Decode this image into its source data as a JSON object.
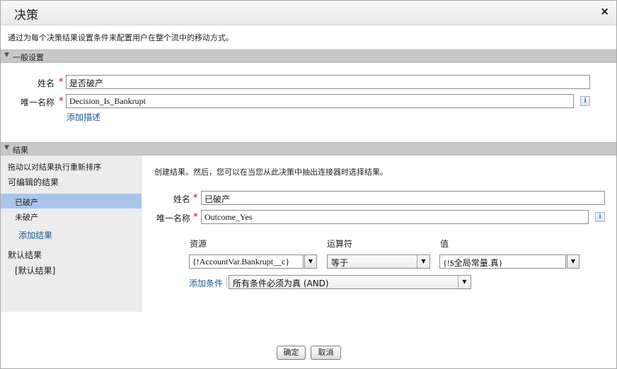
{
  "dialog": {
    "title": "决策",
    "close_glyph": "×",
    "description": "通过为每个决策结果设置条件来配置用户在整个流中的移动方式。"
  },
  "general": {
    "section_title": "一般设置",
    "collapse_glyph": "▼",
    "name_label": "姓名",
    "name_value": "是否破产",
    "unique_label": "唯一名称",
    "unique_value": "Decision_Is_Bankrupt",
    "add_description": "添加描述",
    "info_glyph": "i"
  },
  "results": {
    "section_title": "结果",
    "collapse_glyph": "▼",
    "drag_hint": "拖动以对结果执行重新排序",
    "editable_heading": "可编辑的结果",
    "items": [
      "已破产",
      "未破产"
    ],
    "selected_index": 0,
    "add_result": "添加结果",
    "default_heading": "默认结果",
    "default_item": "[默认结果]"
  },
  "outcome": {
    "intro": "创建结果。然后，您可以在当您从此决策中抽出连接器时选择结果。",
    "name_label": "姓名",
    "name_value": "已破产",
    "unique_label": "唯一名称",
    "unique_value": "Outcome_Yes",
    "info_glyph": "i",
    "columns": {
      "resource": "资源",
      "operator": "运算符",
      "value": "值"
    },
    "condition": {
      "resource": "{!AccountVar.Bankrupt__c}",
      "operator": "等于",
      "value": "{!$全局常量.真}"
    },
    "add_condition": "添加条件",
    "logic": "所有条件必须为真 (AND)",
    "dropdown_glyph": "▼",
    "required_glyph": "*"
  },
  "footer": {
    "ok_label": "确定",
    "cancel_label": "取消"
  }
}
